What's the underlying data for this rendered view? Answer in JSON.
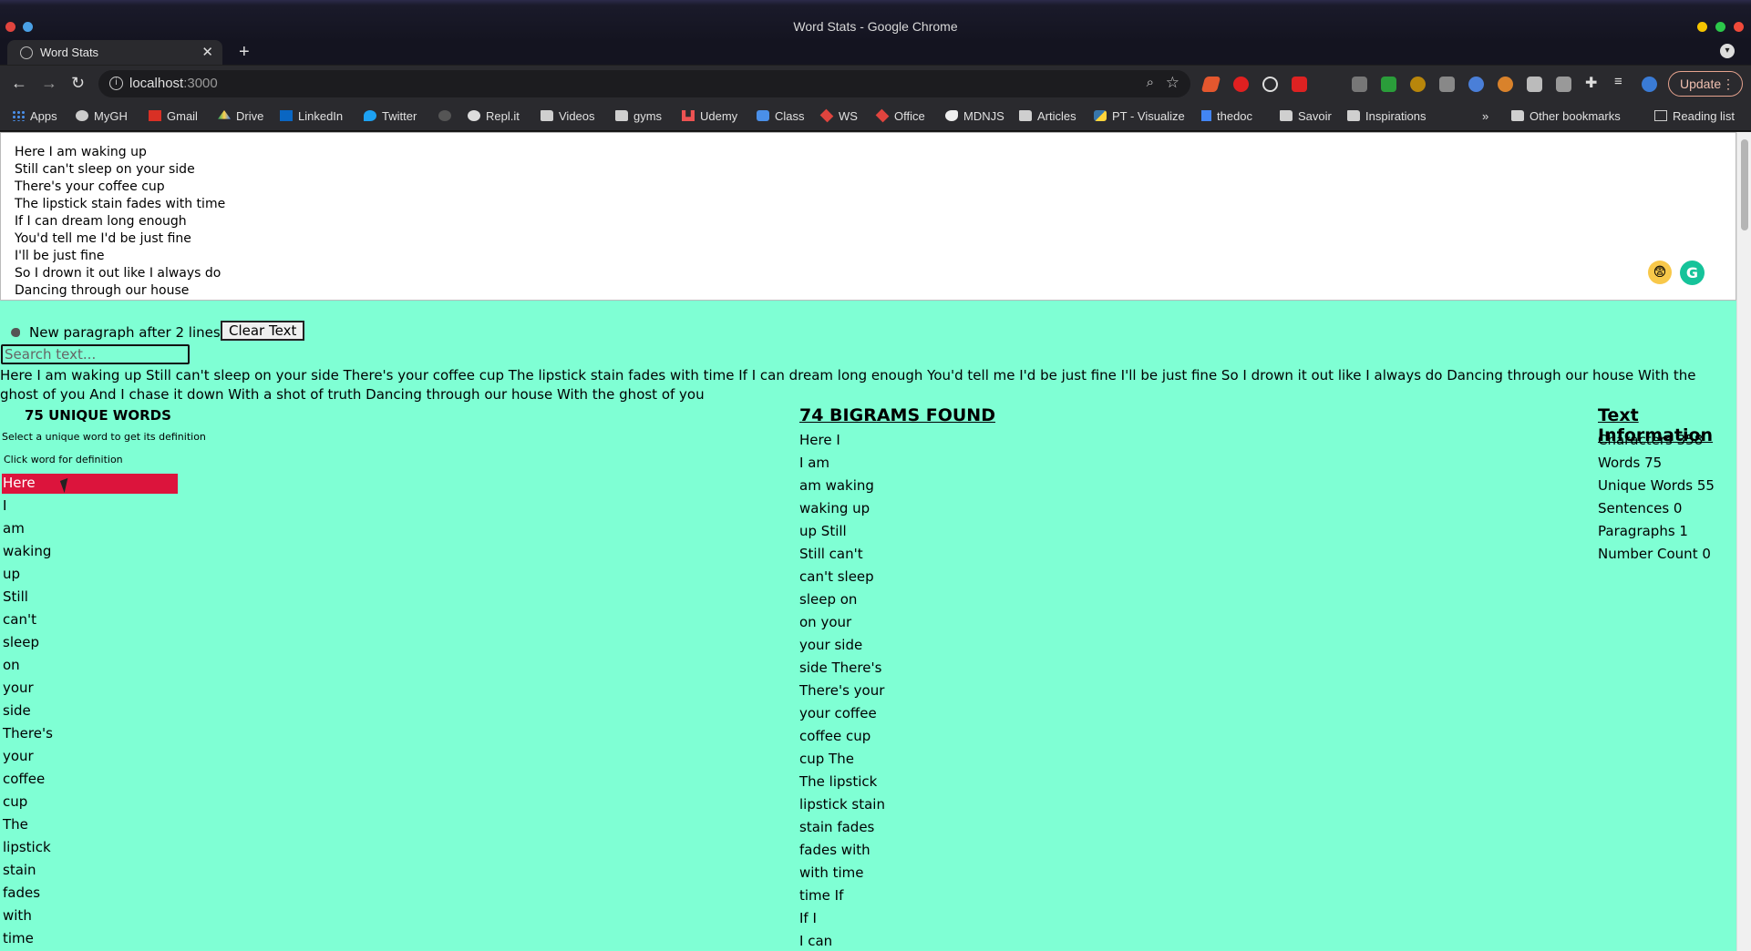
{
  "window": {
    "title": "Word Stats - Google Chrome"
  },
  "tab": {
    "title": "Word Stats"
  },
  "address_bar": {
    "host": "localhost",
    "port": ":3000"
  },
  "toolbar": {
    "update_label": "Update"
  },
  "bookmarks": [
    {
      "label": "Apps",
      "icon": "apps-grid-icon"
    },
    {
      "label": "MyGH",
      "icon": "github-icon"
    },
    {
      "label": "Gmail",
      "icon": "gmail-icon"
    },
    {
      "label": "Drive",
      "icon": "drive-icon"
    },
    {
      "label": "LinkedIn",
      "icon": "linkedin-icon"
    },
    {
      "label": "Twitter",
      "icon": "twitter-icon"
    },
    {
      "label": "",
      "icon": "github-icon"
    },
    {
      "label": "Repl.it",
      "icon": "replit-icon"
    },
    {
      "label": "Videos",
      "icon": "folder-icon"
    },
    {
      "label": "gyms",
      "icon": "folder-icon"
    },
    {
      "label": "Udemy",
      "icon": "udemy-icon"
    },
    {
      "label": "Class",
      "icon": "class-icon"
    },
    {
      "label": "WS",
      "icon": "ws-icon"
    },
    {
      "label": "Office",
      "icon": "office-icon"
    },
    {
      "label": "MDNJS",
      "icon": "mdn-icon"
    },
    {
      "label": "Articles",
      "icon": "folder-icon"
    },
    {
      "label": "PT - Visualize",
      "icon": "python-icon"
    },
    {
      "label": "thedoc",
      "icon": "docs-icon"
    },
    {
      "label": "Savoir",
      "icon": "folder-icon"
    },
    {
      "label": "Inspirations",
      "icon": "folder-icon"
    }
  ],
  "bookmarks_right": {
    "other": "Other bookmarks",
    "reading": "Reading list"
  },
  "textarea": {
    "lines": [
      "Here I am waking up",
      "Still can't sleep on your side",
      "There's your coffee cup",
      "The lipstick stain fades with time",
      "If I can dream long enough",
      "You'd tell me I'd be just fine",
      "I'll be just fine",
      "So I drown it out like I always do",
      "Dancing through our house"
    ]
  },
  "controls": {
    "toggle_label": "New paragraph after 2 lines",
    "clear_label": "Clear Text",
    "search_placeholder": "Search text..."
  },
  "preview_text": "Here I am waking up Still can't sleep on your side There's your coffee cup The lipstick stain fades with time If I can dream long enough You'd tell me I'd be just fine I'll be just fine So I drown it out like I always do Dancing through our house With the ghost of you And I chase it down With a shot of truth Dancing through our house With the ghost of you",
  "unique_words": {
    "title": "75 UNIQUE WORDS",
    "hint1": "Select a unique word to get its definition",
    "hint2": "Click word for definition",
    "selected": "Here",
    "items": [
      "Here",
      "I",
      "am",
      "waking",
      "up",
      "Still",
      "can't",
      "sleep",
      "on",
      "your",
      "side",
      "There's",
      "your",
      "coffee",
      "cup",
      "The",
      "lipstick",
      "stain",
      "fades",
      "with",
      "time"
    ]
  },
  "bigrams": {
    "title": "74 BIGRAMS FOUND",
    "items": [
      "Here I",
      "I am",
      "am waking",
      "waking up",
      "up Still",
      "Still can't",
      "can't sleep",
      "sleep on",
      "on your",
      "your side",
      "side There's",
      "There's your",
      "your coffee",
      "coffee cup",
      "cup The",
      "The lipstick",
      "lipstick stain",
      "stain fades",
      "fades with",
      "with time",
      "time If",
      "If I",
      "I can"
    ]
  },
  "text_information": {
    "title": "Text Information",
    "items": [
      "Characters 358",
      "Words 75",
      "Unique Words 55",
      "Sentences 0",
      "Paragraphs 1",
      "Number Count 0"
    ]
  },
  "colors": {
    "page_bg": "#7fffd4",
    "selected_word_bg": "#dc143c"
  }
}
